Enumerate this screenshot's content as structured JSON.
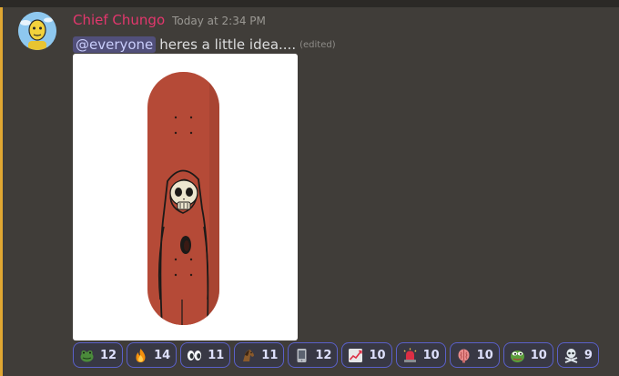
{
  "message": {
    "author": "Chief Chungo",
    "timestamp": "Today at 2:34 PM",
    "mention": "@everyone",
    "text": "heres a little idea....",
    "edited": "(edited)",
    "author_color": "#e3376d",
    "attachment": {
      "subject": "red skateboard deck with skull-faced hooded figure",
      "deck_color": "#b54a37"
    }
  },
  "reactions": [
    {
      "icon": "frog-icon",
      "count": "12"
    },
    {
      "icon": "fire-icon",
      "count": "14"
    },
    {
      "icon": "eyes-icon",
      "count": "11"
    },
    {
      "icon": "horse-icon",
      "count": "11"
    },
    {
      "icon": "tablet-icon",
      "count": "12"
    },
    {
      "icon": "chart-increasing-icon",
      "count": "10"
    },
    {
      "icon": "siren-icon",
      "count": "10"
    },
    {
      "icon": "brain-icon",
      "count": "10"
    },
    {
      "icon": "pepe-icon",
      "count": "10"
    },
    {
      "icon": "skull-crossbones-icon",
      "count": "9"
    }
  ]
}
